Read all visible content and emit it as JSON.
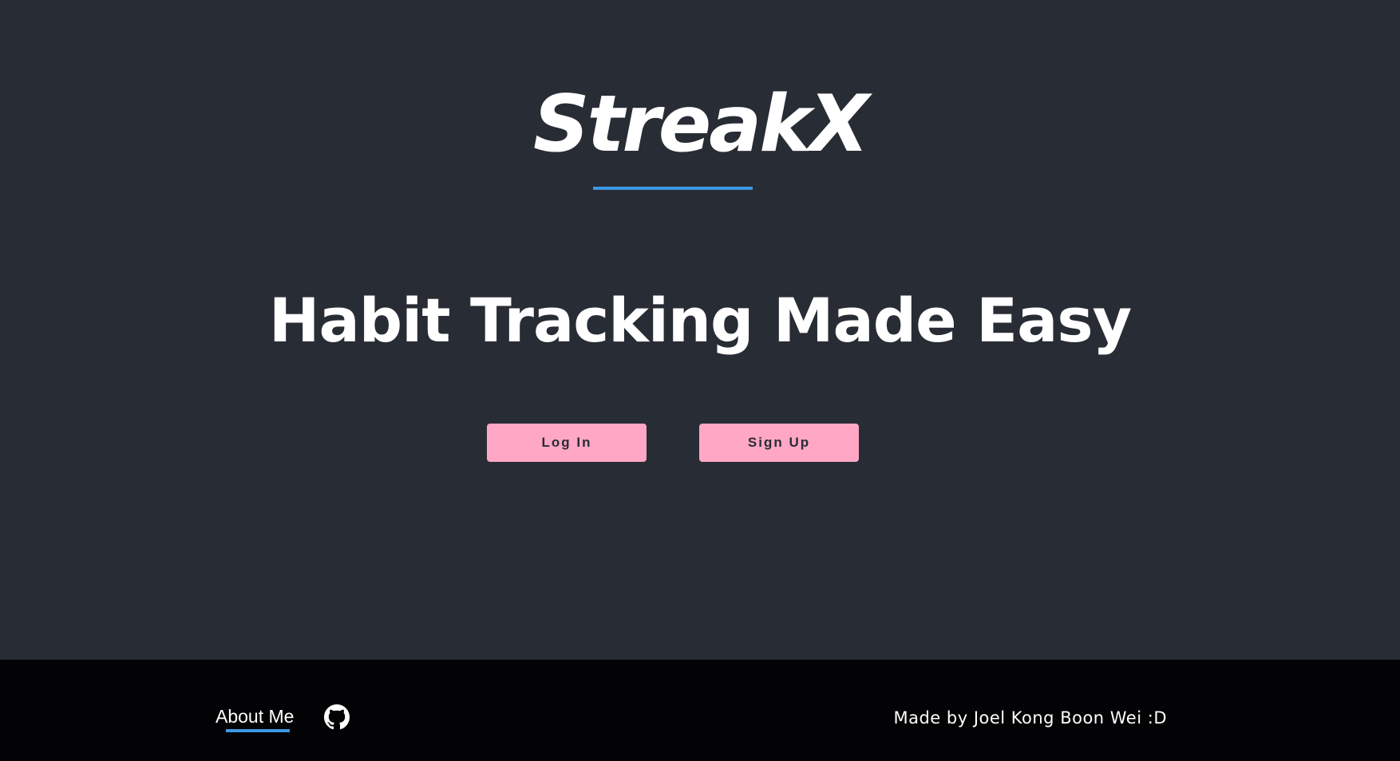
{
  "hero": {
    "brand": "StreakX",
    "headline": "Habit Tracking Made Easy",
    "accent_color": "#3b97e3"
  },
  "actions": {
    "login_label": "Log In",
    "signup_label": "Sign Up",
    "button_color": "#ffa7c4"
  },
  "footer": {
    "about_label": "About Me",
    "github_icon": "github-icon",
    "credit": "Made by Joel Kong Boon Wei :D"
  },
  "colors": {
    "background": "#282c35",
    "footer_background": "#030204",
    "text": "#ffffff"
  }
}
